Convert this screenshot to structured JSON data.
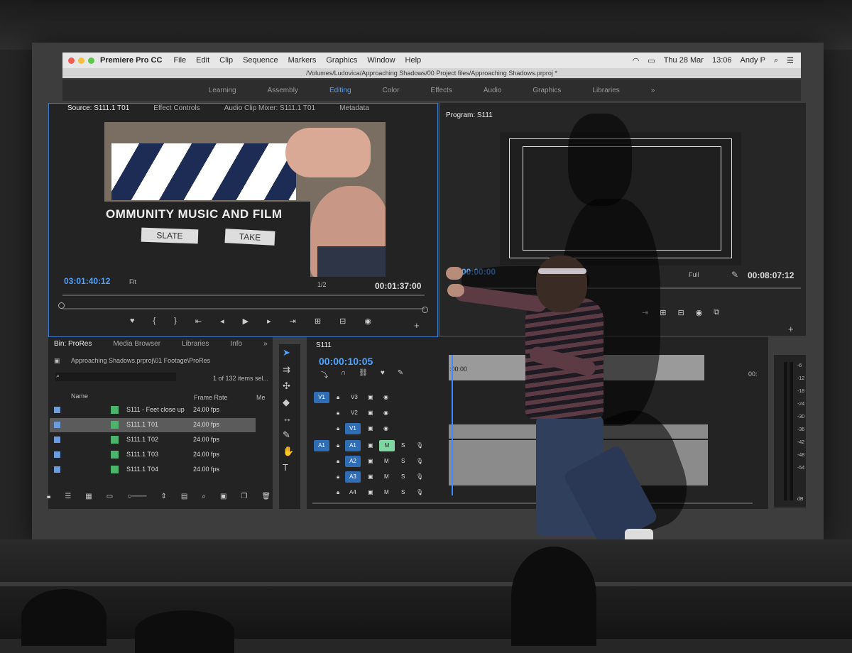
{
  "menubar": {
    "app": "Premiere Pro CC",
    "menus": [
      "File",
      "Edit",
      "Clip",
      "Sequence",
      "Markers",
      "Graphics",
      "Window",
      "Help"
    ],
    "date": "Thu 28 Mar",
    "time": "13:06",
    "user": "Andy P"
  },
  "path": "/Volumes/Ludovica/Approaching Shadows/00 Project files/Approaching Shadows.prproj *",
  "workspaces": [
    "Learning",
    "Assembly",
    "Editing",
    "Color",
    "Effects",
    "Audio",
    "Graphics",
    "Libraries",
    "»"
  ],
  "source": {
    "tabs": [
      "Source: S111.1 T01",
      "Effect Controls",
      "Audio Clip Mixer: S111.1 T01",
      "Metadata"
    ],
    "slate_text": "OMMUNITY MUSIC AND FILM",
    "slate_label": "SLATE",
    "take_label": "TAKE",
    "timecode_in": "03:01:40:12",
    "fit": "Fit",
    "resolution": "1/2",
    "timecode_dur": "00:01:37:00"
  },
  "program": {
    "tab": "Program: S111",
    "timecode_in": "00:00:00",
    "full": "Full",
    "timecode_dur": "00:08:07:12"
  },
  "project": {
    "tabs": [
      "Bin: ProRes",
      "Media Browser",
      "Libraries",
      "Info",
      "»"
    ],
    "breadcrumb": "Approaching Shadows.prproj\\01 Footage\\ProRes",
    "count": "1 of 132 items sel...",
    "col_name": "Name",
    "col_rate": "Frame Rate",
    "col_me": "Me",
    "rows": [
      {
        "name": "S111 - Feet close up",
        "rate": "24.00 fps"
      },
      {
        "name": "S111.1 T01",
        "rate": "24.00 fps"
      },
      {
        "name": "S111.1 T02",
        "rate": "24.00 fps"
      },
      {
        "name": "S111.1 T03",
        "rate": "24.00 fps"
      },
      {
        "name": "S111.1 T04",
        "rate": "24.00 fps"
      }
    ]
  },
  "timeline": {
    "tab": "S111",
    "timecode": "00:00:10:05",
    "ruler_start": ":00:00",
    "ruler_end": "00:",
    "video_tracks": [
      "V3",
      "V2",
      "V1"
    ],
    "audio_tracks": [
      "A1",
      "A2",
      "A3",
      "A4"
    ],
    "source_v": "V1",
    "source_a": "A1",
    "mute": "M",
    "solo": "S"
  },
  "meter_scale": [
    "-6",
    "-12",
    "-18",
    "-24",
    "-30",
    "-36",
    "-42",
    "-48",
    "-54",
    "dB"
  ],
  "colors": {
    "accent": "#4fa3ff",
    "panel": "#232323",
    "clip": "#8b8b8b",
    "bin_item": "#4bb36c"
  }
}
